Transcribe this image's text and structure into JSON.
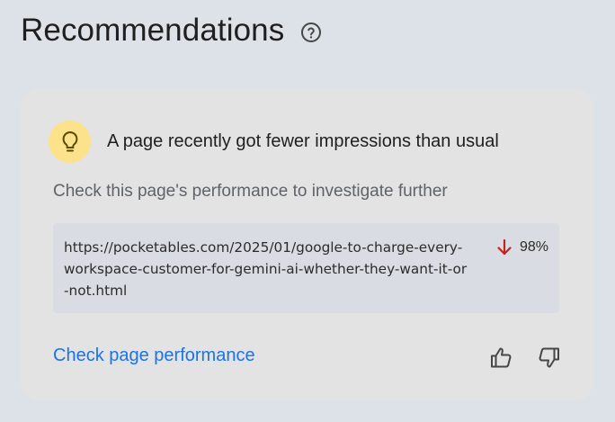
{
  "header": {
    "title": "Recommendations",
    "help_icon": "help-circle-icon"
  },
  "card": {
    "icon": "lightbulb-icon",
    "title": "A page recently got fewer impressions than usual",
    "subtitle": "Check this page's performance to investigate further",
    "url": "https://pocketables.com/2025/01/google-to-charge-every-workspace-customer-for-gemini-ai-whether-they-want-it-or-not.html",
    "change": {
      "direction": "down",
      "value": "98%",
      "color": "#c5221f"
    },
    "action_label": "Check page performance",
    "feedback": {
      "positive_icon": "thumbs-up-icon",
      "negative_icon": "thumbs-down-icon"
    }
  },
  "colors": {
    "background": "#dde1e8",
    "card": "#e3e3e3",
    "accent": "#1a73e8",
    "bulb_bg": "#fce28a"
  }
}
